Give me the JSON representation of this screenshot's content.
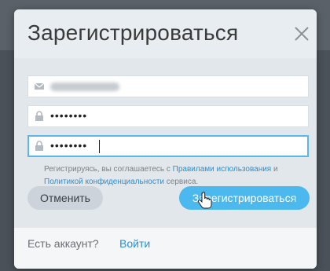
{
  "dialog": {
    "title": "Зарегистрироваться",
    "close_icon": "close-icon"
  },
  "form": {
    "email": {
      "icon": "envelope-icon",
      "value": ""
    },
    "password": {
      "icon": "lock-icon",
      "value": "••••••••"
    },
    "password_confirm": {
      "icon": "lock-icon",
      "value": "••••••••"
    }
  },
  "consent": {
    "prefix": "Регистрируясь, вы соглашаетесь с ",
    "terms_link": "Правилами использования",
    "middle": " и ",
    "privacy_link": "Политикой конфиденциальности",
    "suffix": " сервиса."
  },
  "buttons": {
    "cancel": "Отменить",
    "register": "Зарегистрироваться"
  },
  "footer": {
    "question": "Есть аккаунт?",
    "login_link": "Войти"
  },
  "colors": {
    "accent": "#4bb8ee",
    "link": "#2a8fd1",
    "focus_border": "#5ab7e6"
  }
}
